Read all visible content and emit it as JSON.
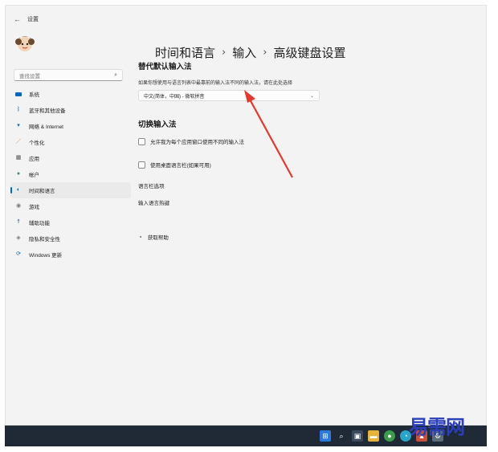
{
  "window": {
    "title": "设置"
  },
  "search": {
    "placeholder": "查找设置"
  },
  "sidebar": {
    "items": [
      {
        "label": "系统",
        "icon": "monitor-icon",
        "color": "#0067c0"
      },
      {
        "label": "蓝牙和其他设备",
        "icon": "bluetooth-icon",
        "color": "#0067c0"
      },
      {
        "label": "网络 & Internet",
        "icon": "wifi-icon",
        "color": "#0067c0"
      },
      {
        "label": "个性化",
        "icon": "brush-icon",
        "color": "#e0823a"
      },
      {
        "label": "应用",
        "icon": "apps-icon",
        "color": "#555555"
      },
      {
        "label": "帐户",
        "icon": "person-icon",
        "color": "#2f9e58"
      },
      {
        "label": "时间和语言",
        "icon": "globe-clock-icon",
        "color": "#0067c0",
        "active": true
      },
      {
        "label": "游戏",
        "icon": "gamepad-icon",
        "color": "#777777"
      },
      {
        "label": "辅助功能",
        "icon": "accessibility-icon",
        "color": "#1a5fb4"
      },
      {
        "label": "隐私和安全性",
        "icon": "shield-icon",
        "color": "#777777"
      },
      {
        "label": "Windows 更新",
        "icon": "update-icon",
        "color": "#0067c0"
      }
    ]
  },
  "breadcrumb": [
    "时间和语言",
    "输入",
    "高级键盘设置"
  ],
  "override_section": {
    "title": "替代默认输入法",
    "description": "如果你想使用与语言列表中最靠前的输入法不同的输入法，请在此处选择",
    "dropdown_value": "中文(简体，中国) - 微软拼音"
  },
  "switch_section": {
    "title": "切换输入法",
    "checkbox1_label": "允许我为每个应用窗口使用不同的输入法",
    "checkbox2_label": "使用桌面语言栏(如果可用)"
  },
  "links": {
    "language_bar_options": "语言栏选项",
    "input_hotkeys": "输入语言热键"
  },
  "help": {
    "label": "获取帮助"
  },
  "watermark": {
    "text": "易需网"
  },
  "colors": {
    "accent": "#0067c0",
    "annotation_arrow": "#e0392e"
  }
}
